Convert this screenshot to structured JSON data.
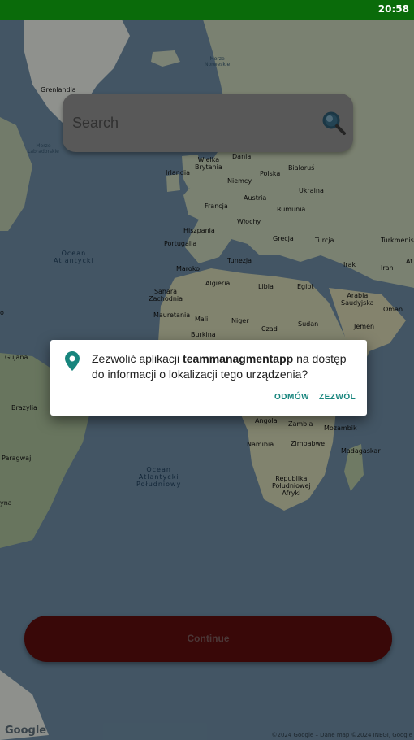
{
  "status_bar": {
    "time": "20:58"
  },
  "search": {
    "placeholder": "Search"
  },
  "map": {
    "labels": {
      "grenlandia": "Grenlandia",
      "morze_norweskie": "Morze\nNorweskie",
      "morze_labradorskie": "Morze\nLabradorskie",
      "wielka_brytania": "Wielka\nBrytania",
      "dania": "Dania",
      "irlandia": "Irlandia",
      "niemcy": "Niemcy",
      "polska": "Polska",
      "bialorus": "Białoruś",
      "ukraina": "Ukraina",
      "francja": "Francja",
      "austria": "Austria",
      "rumunia": "Rumunia",
      "wlochy": "Włochy",
      "hiszpania": "Hiszpania",
      "portugalia": "Portugalia",
      "grecja": "Grecja",
      "turcja": "Turcja",
      "turkmenis": "Turkmenis",
      "tunezja": "Tunezja",
      "maroko": "Maroko",
      "algieria": "Algieria",
      "libia": "Libia",
      "egipt": "Egipt",
      "irak": "Irak",
      "iran": "Iran",
      "afg": "Af",
      "sahara": "Sahara\nZachodnia",
      "arabia": "Arabia\nSaudyjska",
      "oman": "Oman",
      "mauretania": "Mauretania",
      "mali": "Mali",
      "niger": "Niger",
      "czad": "Czad",
      "sudan": "Sudan",
      "jemen": "Jemen",
      "burkina": "Burkina",
      "gujana": "Gujana",
      "brazylia": "Brazylia",
      "paragwaj": "Paragwaj",
      "argentyna": "yna",
      "angola": "Angola",
      "zambia": "Zambia",
      "mozambik": "Mozambik",
      "namibia": "Namibia",
      "zimbabwe": "Zimbabwe",
      "madagaskar": "Madagaskar",
      "rpa": "Republika\nPołudniowej\nAfryki",
      "ocean_atlantycki": "Ocean\nAtlantycki",
      "ocean_atlantycki_pld": "Ocean\nAtlantycki\nPołudniowy",
      "edge_o": "o"
    },
    "google_logo": "Google",
    "attribution": "©2024 Google – Dane map ©2024 INEGI, Google"
  },
  "dialog": {
    "icon": "location-pin-icon",
    "message_prefix": "Zezwolić aplikacji ",
    "app_name": "teammanagmentapp",
    "message_suffix": " na dostęp do informacji o lokalizacji tego urządzenia?",
    "deny_label": "ODMÓW",
    "allow_label": "ZEZWÓL"
  },
  "continue_button": {
    "label": "Continue"
  },
  "colors": {
    "status_bar": "#0a6b0a",
    "continue_button": "#5c0d0d",
    "dialog_accent": "#17857d",
    "ocean": "#6c8aa2",
    "land": "#c9d3bd"
  }
}
